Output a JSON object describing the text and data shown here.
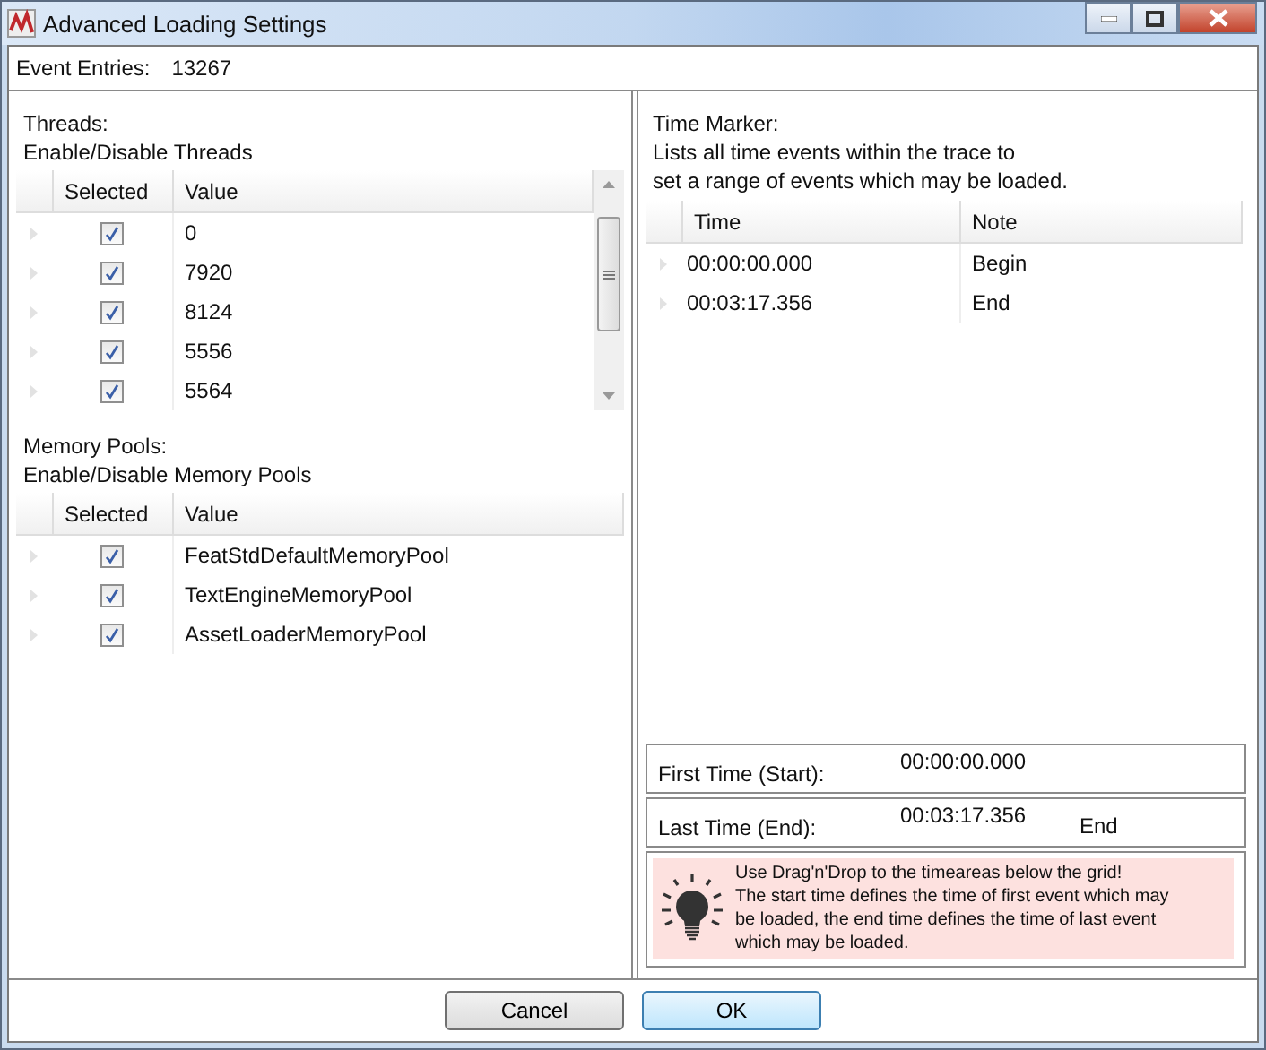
{
  "window": {
    "title": "Advanced Loading Settings"
  },
  "event_entries": {
    "label": "Event Entries:",
    "value": "13267"
  },
  "threads": {
    "title": "Threads:",
    "subtitle": "Enable/Disable Threads",
    "columns": [
      "Selected",
      "Value"
    ],
    "rows": [
      {
        "checked": true,
        "value": "0"
      },
      {
        "checked": true,
        "value": "7920"
      },
      {
        "checked": true,
        "value": "8124"
      },
      {
        "checked": true,
        "value": "5556"
      },
      {
        "checked": true,
        "value": "5564"
      }
    ]
  },
  "memory_pools": {
    "title": "Memory Pools:",
    "subtitle": "Enable/Disable Memory Pools",
    "columns": [
      "Selected",
      "Value"
    ],
    "rows": [
      {
        "checked": true,
        "value": "FeatStdDefaultMemoryPool"
      },
      {
        "checked": true,
        "value": "TextEngineMemoryPool"
      },
      {
        "checked": true,
        "value": "AssetLoaderMemoryPool"
      }
    ]
  },
  "time_marker": {
    "title": "Time Marker:",
    "description": [
      "Lists all time events within the trace to",
      "set a range of events which may be loaded."
    ],
    "columns": [
      "Time",
      "Note"
    ],
    "rows": [
      {
        "time": "00:00:00.000",
        "note": "Begin"
      },
      {
        "time": "00:03:17.356",
        "note": "End"
      }
    ]
  },
  "first_time": {
    "label": "First Time (Start):",
    "value": "00:00:00.000"
  },
  "last_time": {
    "label": "Last Time (End):",
    "value": "00:03:17.356",
    "note": "End"
  },
  "hint": {
    "lines": [
      "Use Drag'n'Drop to the timeareas below the grid!",
      "The start time defines the time of first event which may",
      "be loaded, the end time defines the time of last event",
      "which may be loaded."
    ]
  },
  "buttons": [
    {
      "label": "Cancel",
      "kind": "normal"
    },
    {
      "label": "OK",
      "kind": "default"
    }
  ]
}
